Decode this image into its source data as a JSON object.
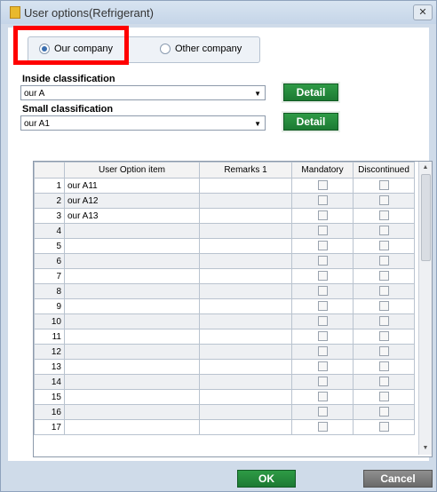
{
  "window": {
    "title": "User options(Refrigerant)",
    "close_glyph": "✕"
  },
  "company_selector": {
    "options": [
      {
        "label": "Our company",
        "selected": true
      },
      {
        "label": "Other company",
        "selected": false
      }
    ]
  },
  "inside_classification": {
    "label": "Inside classification",
    "value": "our A",
    "detail_label": "Detail"
  },
  "small_classification": {
    "label": "Small classification",
    "value": "our A1",
    "detail_label": "Detail"
  },
  "grid": {
    "columns": [
      "User Option item",
      "Remarks 1",
      "Mandatory",
      "Discontinued"
    ],
    "rows": [
      {
        "no": "1",
        "item": "our A11"
      },
      {
        "no": "2",
        "item": "our A12"
      },
      {
        "no": "3",
        "item": "our A13"
      },
      {
        "no": "4",
        "item": ""
      },
      {
        "no": "5",
        "item": ""
      },
      {
        "no": "6",
        "item": ""
      },
      {
        "no": "7",
        "item": ""
      },
      {
        "no": "8",
        "item": ""
      },
      {
        "no": "9",
        "item": ""
      },
      {
        "no": "10",
        "item": ""
      },
      {
        "no": "11",
        "item": ""
      },
      {
        "no": "12",
        "item": ""
      },
      {
        "no": "13",
        "item": ""
      },
      {
        "no": "14",
        "item": ""
      },
      {
        "no": "15",
        "item": ""
      },
      {
        "no": "16",
        "item": ""
      },
      {
        "no": "17",
        "item": ""
      }
    ]
  },
  "footer": {
    "ok_label": "OK",
    "cancel_label": "Cancel"
  },
  "colors": {
    "accent": "#1d7a33",
    "highlight": "#ff0000"
  }
}
